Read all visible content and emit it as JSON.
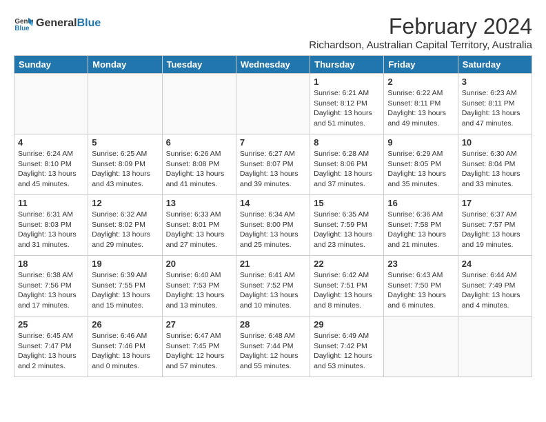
{
  "logo": {
    "general": "General",
    "blue": "Blue"
  },
  "title": "February 2024",
  "subtitle": "Richardson, Australian Capital Territory, Australia",
  "days_of_week": [
    "Sunday",
    "Monday",
    "Tuesday",
    "Wednesday",
    "Thursday",
    "Friday",
    "Saturday"
  ],
  "weeks": [
    [
      {
        "day": "",
        "text": ""
      },
      {
        "day": "",
        "text": ""
      },
      {
        "day": "",
        "text": ""
      },
      {
        "day": "",
        "text": ""
      },
      {
        "day": "1",
        "text": "Sunrise: 6:21 AM\nSunset: 8:12 PM\nDaylight: 13 hours\nand 51 minutes."
      },
      {
        "day": "2",
        "text": "Sunrise: 6:22 AM\nSunset: 8:11 PM\nDaylight: 13 hours\nand 49 minutes."
      },
      {
        "day": "3",
        "text": "Sunrise: 6:23 AM\nSunset: 8:11 PM\nDaylight: 13 hours\nand 47 minutes."
      }
    ],
    [
      {
        "day": "4",
        "text": "Sunrise: 6:24 AM\nSunset: 8:10 PM\nDaylight: 13 hours\nand 45 minutes."
      },
      {
        "day": "5",
        "text": "Sunrise: 6:25 AM\nSunset: 8:09 PM\nDaylight: 13 hours\nand 43 minutes."
      },
      {
        "day": "6",
        "text": "Sunrise: 6:26 AM\nSunset: 8:08 PM\nDaylight: 13 hours\nand 41 minutes."
      },
      {
        "day": "7",
        "text": "Sunrise: 6:27 AM\nSunset: 8:07 PM\nDaylight: 13 hours\nand 39 minutes."
      },
      {
        "day": "8",
        "text": "Sunrise: 6:28 AM\nSunset: 8:06 PM\nDaylight: 13 hours\nand 37 minutes."
      },
      {
        "day": "9",
        "text": "Sunrise: 6:29 AM\nSunset: 8:05 PM\nDaylight: 13 hours\nand 35 minutes."
      },
      {
        "day": "10",
        "text": "Sunrise: 6:30 AM\nSunset: 8:04 PM\nDaylight: 13 hours\nand 33 minutes."
      }
    ],
    [
      {
        "day": "11",
        "text": "Sunrise: 6:31 AM\nSunset: 8:03 PM\nDaylight: 13 hours\nand 31 minutes."
      },
      {
        "day": "12",
        "text": "Sunrise: 6:32 AM\nSunset: 8:02 PM\nDaylight: 13 hours\nand 29 minutes."
      },
      {
        "day": "13",
        "text": "Sunrise: 6:33 AM\nSunset: 8:01 PM\nDaylight: 13 hours\nand 27 minutes."
      },
      {
        "day": "14",
        "text": "Sunrise: 6:34 AM\nSunset: 8:00 PM\nDaylight: 13 hours\nand 25 minutes."
      },
      {
        "day": "15",
        "text": "Sunrise: 6:35 AM\nSunset: 7:59 PM\nDaylight: 13 hours\nand 23 minutes."
      },
      {
        "day": "16",
        "text": "Sunrise: 6:36 AM\nSunset: 7:58 PM\nDaylight: 13 hours\nand 21 minutes."
      },
      {
        "day": "17",
        "text": "Sunrise: 6:37 AM\nSunset: 7:57 PM\nDaylight: 13 hours\nand 19 minutes."
      }
    ],
    [
      {
        "day": "18",
        "text": "Sunrise: 6:38 AM\nSunset: 7:56 PM\nDaylight: 13 hours\nand 17 minutes."
      },
      {
        "day": "19",
        "text": "Sunrise: 6:39 AM\nSunset: 7:55 PM\nDaylight: 13 hours\nand 15 minutes."
      },
      {
        "day": "20",
        "text": "Sunrise: 6:40 AM\nSunset: 7:53 PM\nDaylight: 13 hours\nand 13 minutes."
      },
      {
        "day": "21",
        "text": "Sunrise: 6:41 AM\nSunset: 7:52 PM\nDaylight: 13 hours\nand 10 minutes."
      },
      {
        "day": "22",
        "text": "Sunrise: 6:42 AM\nSunset: 7:51 PM\nDaylight: 13 hours\nand 8 minutes."
      },
      {
        "day": "23",
        "text": "Sunrise: 6:43 AM\nSunset: 7:50 PM\nDaylight: 13 hours\nand 6 minutes."
      },
      {
        "day": "24",
        "text": "Sunrise: 6:44 AM\nSunset: 7:49 PM\nDaylight: 13 hours\nand 4 minutes."
      }
    ],
    [
      {
        "day": "25",
        "text": "Sunrise: 6:45 AM\nSunset: 7:47 PM\nDaylight: 13 hours\nand 2 minutes."
      },
      {
        "day": "26",
        "text": "Sunrise: 6:46 AM\nSunset: 7:46 PM\nDaylight: 13 hours\nand 0 minutes."
      },
      {
        "day": "27",
        "text": "Sunrise: 6:47 AM\nSunset: 7:45 PM\nDaylight: 12 hours\nand 57 minutes."
      },
      {
        "day": "28",
        "text": "Sunrise: 6:48 AM\nSunset: 7:44 PM\nDaylight: 12 hours\nand 55 minutes."
      },
      {
        "day": "29",
        "text": "Sunrise: 6:49 AM\nSunset: 7:42 PM\nDaylight: 12 hours\nand 53 minutes."
      },
      {
        "day": "",
        "text": ""
      },
      {
        "day": "",
        "text": ""
      }
    ]
  ]
}
